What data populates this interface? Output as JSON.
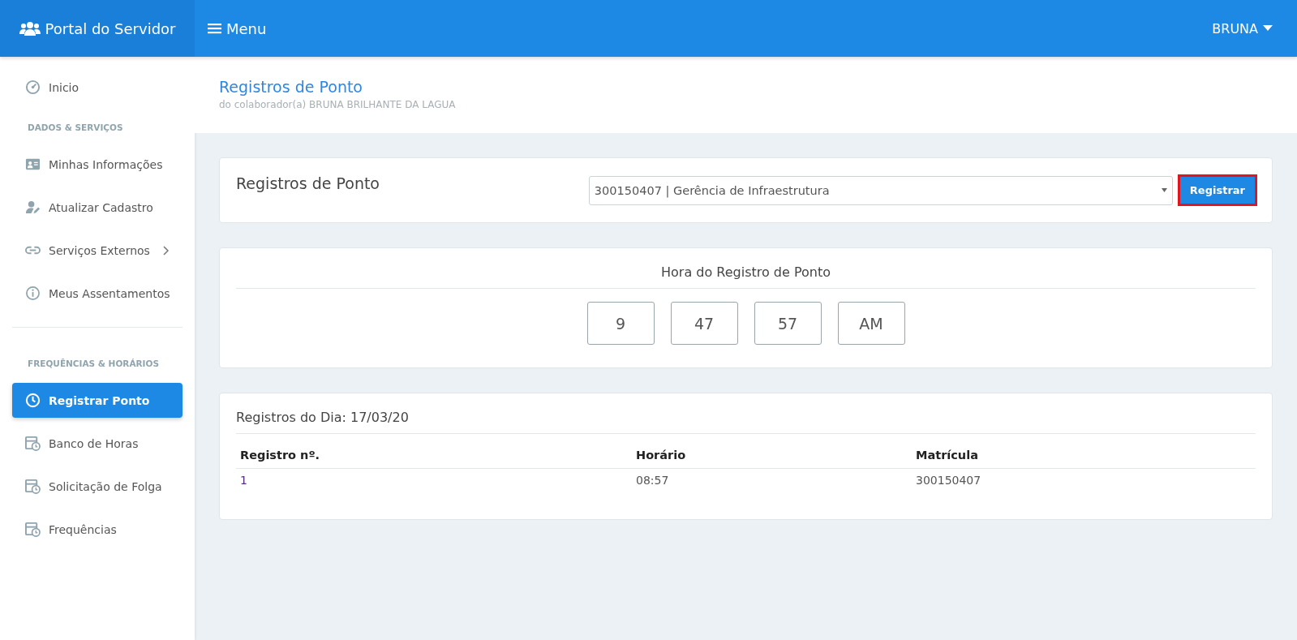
{
  "topbar": {
    "brand": "Portal do Servidor",
    "menu_label": "Menu",
    "user": "BRUNA"
  },
  "sidebar": {
    "items": [
      {
        "kind": "link",
        "label": "Inicio",
        "selected": false
      },
      {
        "kind": "heading",
        "label": "DADOS & SERVIÇOS"
      },
      {
        "kind": "link",
        "label": "Minhas Informações",
        "selected": false
      },
      {
        "kind": "link",
        "label": "Atualizar Cadastro",
        "selected": false
      },
      {
        "kind": "link",
        "label": "Serviços Externos",
        "selected": false,
        "has_submenu": true
      },
      {
        "kind": "link",
        "label": "Meus Assentamentos",
        "selected": false
      },
      {
        "kind": "divider"
      },
      {
        "kind": "heading",
        "label": "FREQUÊNCIAS & HORÁRIOS"
      },
      {
        "kind": "link",
        "label": "Registrar Ponto",
        "selected": true
      },
      {
        "kind": "link",
        "label": "Banco de Horas",
        "selected": false
      },
      {
        "kind": "link",
        "label": "Solicitação de Folga",
        "selected": false
      },
      {
        "kind": "link",
        "label": "Frequências",
        "selected": false
      }
    ]
  },
  "page_header": {
    "title": "Registros de Ponto",
    "subtitle": "do colaborador(a) BRUNA BRILHANTE DA LAGUA"
  },
  "register_card": {
    "title": "Registros de Ponto",
    "select_value": "300150407 | Gerência de Infraestrutura",
    "button": {
      "label": "Registrar",
      "highlighted": true
    }
  },
  "clock_card": {
    "title": "Hora do Registro de Ponto",
    "parts": [
      "9",
      "47",
      "57",
      "AM"
    ]
  },
  "records_card": {
    "title": "Registros do Dia: 17/03/20",
    "columns": [
      "Registro nº.",
      "Horário",
      "Matrícula"
    ],
    "rows": [
      [
        "1",
        "08:57",
        "300150407"
      ]
    ]
  }
}
